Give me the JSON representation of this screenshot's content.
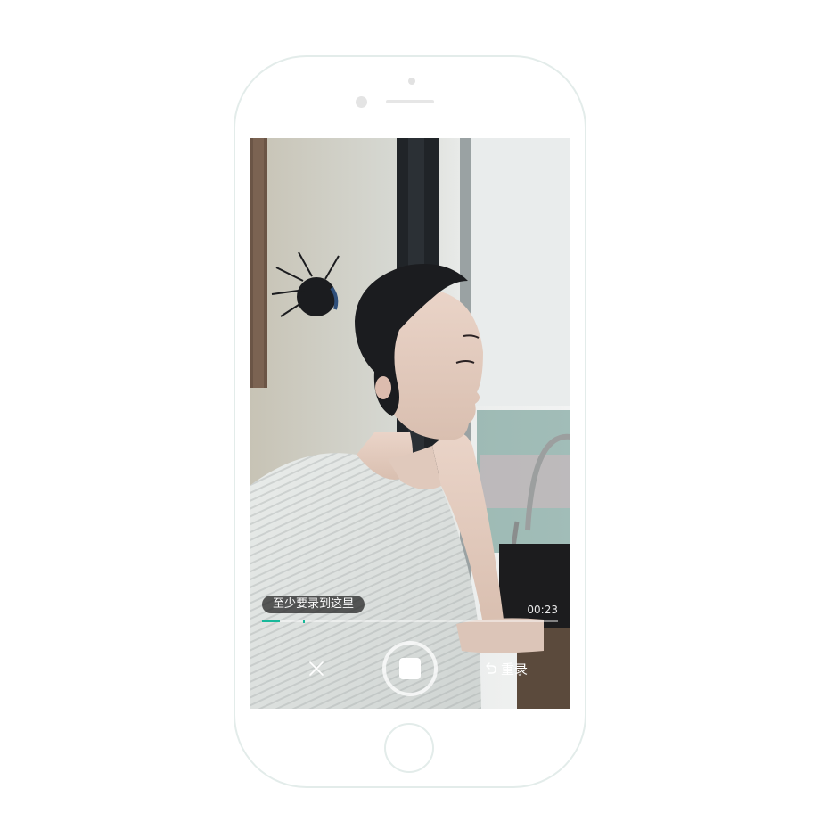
{
  "recorder": {
    "min_duration_tip": "至少要录到这里",
    "elapsed_time": "00:23",
    "progress_fraction": 0.06,
    "min_marker_fraction": 0.14,
    "retake_label": "重录"
  },
  "icons": {
    "cancel": "close-icon",
    "record": "stop-record-icon",
    "retake": "undo-arrow-icon"
  },
  "colors": {
    "accent": "#18b89a",
    "phone_outline": "#e3ecea"
  }
}
